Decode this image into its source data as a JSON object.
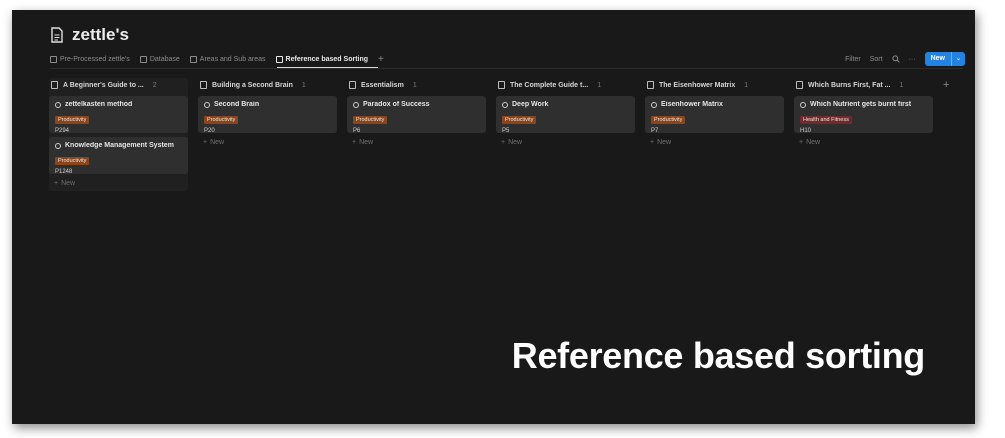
{
  "page": {
    "title": "zettle's",
    "caption": "Reference based sorting"
  },
  "tabs": [
    {
      "label": "Pre-Processed zettle's",
      "icon": "table-icon",
      "active": false
    },
    {
      "label": "Database",
      "icon": "table-icon",
      "active": false
    },
    {
      "label": "Areas and Sub areas",
      "icon": "table-icon",
      "active": false
    },
    {
      "label": "Reference based Sorting",
      "icon": "board-icon",
      "active": true
    }
  ],
  "toolbar": {
    "add_tab": "+",
    "filter": "Filter",
    "sort": "Sort",
    "more": "···",
    "new_label": "New",
    "new_caret": "⌄"
  },
  "columns": [
    {
      "title": "A Beginner's Guide to ...",
      "count": "2",
      "new_label": "New",
      "cards": [
        {
          "title": "zettelkasten method",
          "tag": "Productivity",
          "code": "P294"
        },
        {
          "title": "Knowledge Management System",
          "tag": "Productivity",
          "code": "P1248"
        }
      ]
    },
    {
      "title": "Building a Second Brain",
      "count": "1",
      "new_label": "New",
      "cards": [
        {
          "title": "Second Brain",
          "tag": "Productivity",
          "code": "P20"
        }
      ]
    },
    {
      "title": "Essentialism",
      "count": "1",
      "new_label": "New",
      "cards": [
        {
          "title": "Paradox of Success",
          "tag": "Productivity",
          "code": "P6"
        }
      ]
    },
    {
      "title": "The Complete Guide t...",
      "count": "1",
      "new_label": "New",
      "cards": [
        {
          "title": "Deep Work",
          "tag": "Productivity",
          "code": "P5"
        }
      ]
    },
    {
      "title": "The Eisenhower Matrix",
      "count": "1",
      "new_label": "New",
      "cards": [
        {
          "title": "Eisenhower Matrix",
          "tag": "Productivity",
          "code": "P7"
        }
      ]
    },
    {
      "title": "Which Burns First, Fat ...",
      "count": "1",
      "new_label": "New",
      "cards": [
        {
          "title": "Which Nutrient gets burnt first",
          "tag": "Health and Fitness",
          "code": "H10"
        }
      ]
    }
  ],
  "tag_colors": {
    "Productivity": "#89451e",
    "Health and Fitness": "#6e2a2e"
  },
  "add_column": "+"
}
